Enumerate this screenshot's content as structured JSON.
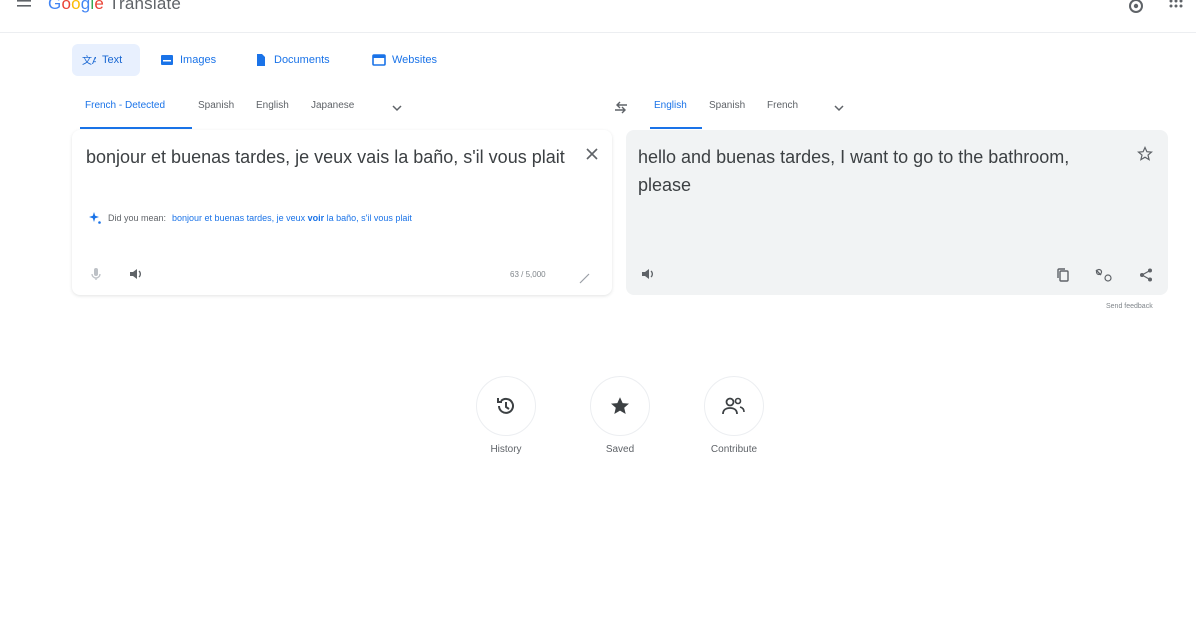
{
  "header": {
    "logo_letters": [
      "G",
      "o",
      "o",
      "g",
      "l",
      "e"
    ],
    "product": "Translate"
  },
  "modes": [
    {
      "label": "Text",
      "icon": "translate-icon",
      "active": true
    },
    {
      "label": "Images",
      "icon": "image-icon",
      "active": false
    },
    {
      "label": "Documents",
      "icon": "document-icon",
      "active": false
    },
    {
      "label": "Websites",
      "icon": "website-icon",
      "active": false
    }
  ],
  "source_langs": [
    "French - Detected",
    "Spanish",
    "English",
    "Japanese"
  ],
  "target_langs": [
    "English",
    "Spanish",
    "French"
  ],
  "source": {
    "text": "bonjour et buenas tardes, je veux vais la baño, s'il vous plait",
    "did_you_mean_label": "Did you mean:",
    "suggestion_pre": "bonjour et buenas tardes, je veux ",
    "suggestion_bold": "voir",
    "suggestion_post": " la baño, s'il vous plait",
    "char_count": "63 / 5,000"
  },
  "target": {
    "text": "hello and buenas tardes, I want to go to the bathroom, please"
  },
  "send_feedback": "Send feedback",
  "bottom": [
    {
      "label": "History",
      "icon": "history-icon"
    },
    {
      "label": "Saved",
      "icon": "star-icon"
    },
    {
      "label": "Contribute",
      "icon": "contribute-icon"
    }
  ],
  "colors": {
    "accent": "#1a73e8",
    "target_bg": "#f1f3f4",
    "text": "#3c4043"
  }
}
